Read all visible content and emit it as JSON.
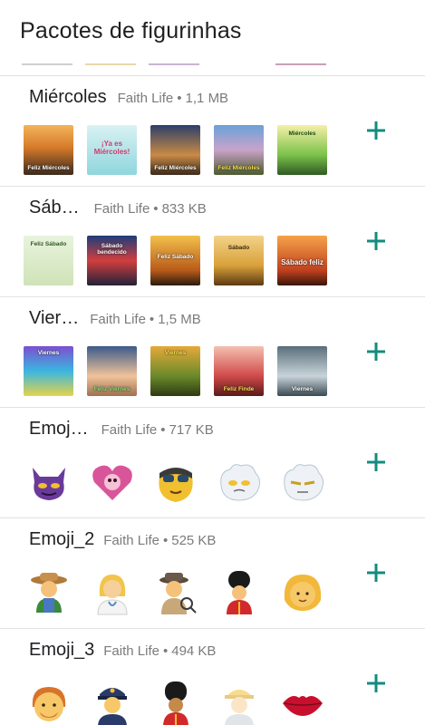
{
  "header": {
    "title": "Pacotes de figurinhas"
  },
  "accent_color": "#128c7e",
  "packs": [
    {
      "name": "Miércoles",
      "author": "Faith Life",
      "size": "1,1 MB",
      "stickers": [
        {
          "style": "bg-sunset",
          "caption": "Feliz Miércoles"
        },
        {
          "style": "bg-teal",
          "caption": "¡Ya es Miércoles!"
        },
        {
          "style": "bg-dusk",
          "caption": "Feliz Miércoles"
        },
        {
          "style": "bg-field",
          "caption": "Feliz Miércoles"
        },
        {
          "style": "bg-green",
          "caption": "Miércoles"
        }
      ]
    },
    {
      "name": "Sáb…",
      "author": "Faith Life",
      "size": "833 KB",
      "stickers": [
        {
          "style": "bg-paper",
          "caption": "Feliz Sábado"
        },
        {
          "style": "bg-ocean",
          "caption": "Sábado bendecido"
        },
        {
          "style": "bg-gold",
          "caption": "Feliz Sábado"
        },
        {
          "style": "bg-sand",
          "caption": "Sábado"
        },
        {
          "style": "bg-red",
          "caption": "Sábado feliz"
        }
      ]
    },
    {
      "name": "Vier…",
      "author": "Faith Life",
      "size": "1,5 MB",
      "stickers": [
        {
          "style": "bg-purple",
          "caption": "Viernes"
        },
        {
          "style": "bg-baby",
          "caption": "Feliz Viernes"
        },
        {
          "style": "bg-flowers",
          "caption": "Viernes"
        },
        {
          "style": "bg-pink",
          "caption": "Feliz Finde"
        },
        {
          "style": "bg-swan",
          "caption": "Viernes"
        }
      ]
    },
    {
      "name": "Emoj…",
      "author": "Faith Life",
      "size": "717 KB",
      "emojis": [
        "purple-demon",
        "pink-heart-face",
        "goggles-face",
        "white-fluffy-blob",
        "white-fluffy-blob-squint"
      ]
    },
    {
      "name": "Emoji_2",
      "author": "Faith Life",
      "size": "525 KB",
      "emojis": [
        "farmer",
        "health-worker",
        "detective",
        "guard",
        "blond-person"
      ]
    },
    {
      "name": "Emoji_3",
      "author": "Faith Life",
      "size": "494 KB",
      "emojis": [
        "man-red-hair",
        "police-officer",
        "guard-dark",
        "construction-worker",
        "lips"
      ]
    }
  ]
}
